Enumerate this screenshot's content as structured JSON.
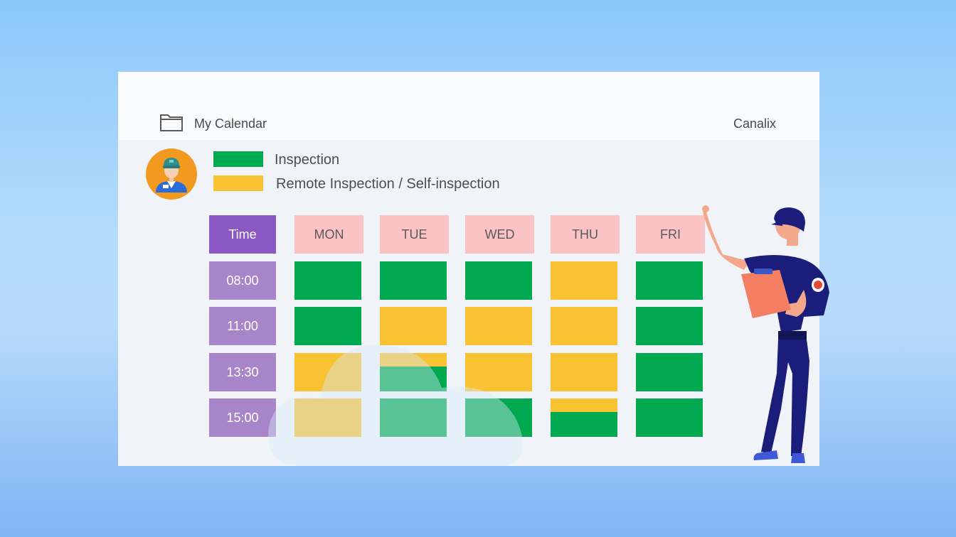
{
  "window": {
    "title": "My Calendar",
    "brand": "Canalix"
  },
  "icons": {
    "folder": "folder-icon",
    "avatar": "inspector-avatar-icon",
    "worker": "inspector-illustration"
  },
  "legend": [
    {
      "label": "Inspection",
      "color": "#00a84f"
    },
    {
      "label": "Remote Inspection / Self-inspection",
      "color": "#f8c232"
    }
  ],
  "schedule": {
    "time_header": "Time",
    "days": [
      "MON",
      "TUE",
      "WED",
      "THU",
      "FRI"
    ],
    "times": [
      "08:00",
      "11:00",
      "13:30",
      "15:00"
    ],
    "slots": [
      [
        "inspection",
        "inspection",
        "inspection",
        "remote",
        "inspection"
      ],
      [
        "inspection",
        "remote",
        "remote",
        "remote",
        "inspection"
      ],
      [
        "remote",
        "remote+inspection",
        "remote",
        "remote",
        "inspection"
      ],
      [
        "remote",
        "inspection",
        "inspection",
        "remote+inspection",
        "inspection"
      ]
    ]
  }
}
